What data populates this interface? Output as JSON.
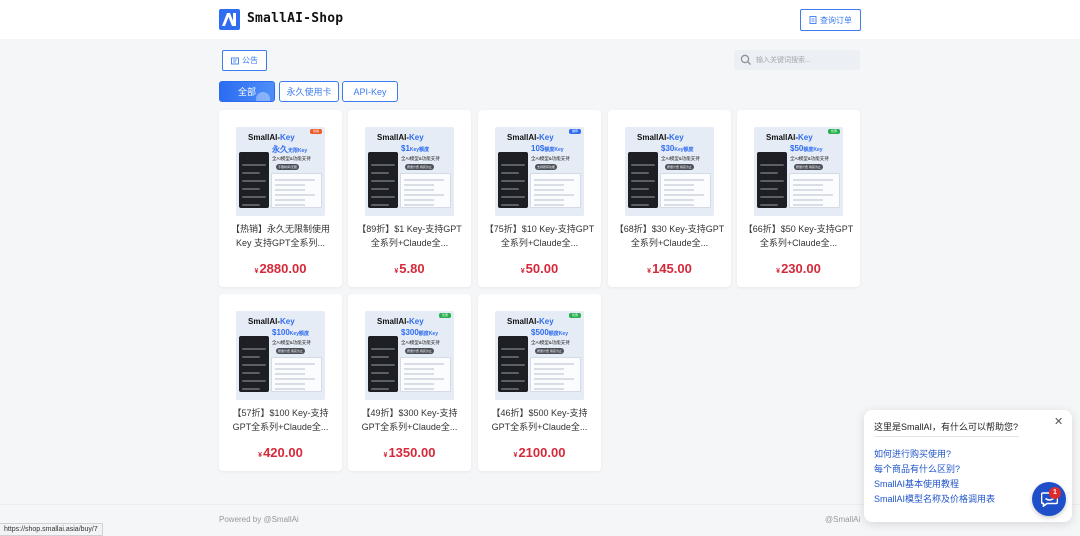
{
  "header": {
    "brand": "SmallAI-Shop",
    "order_button": "查询订单"
  },
  "toolbar": {
    "notice_button": "公告",
    "search_placeholder": "输入关键词搜索..."
  },
  "tabs": [
    {
      "label": "全部",
      "active": true
    },
    {
      "label": "永久使用卡",
      "active": false
    },
    {
      "label": "API-Key",
      "active": false
    }
  ],
  "products": [
    {
      "title": "【热销】永久无限制使用Key 支持GPT全系列...",
      "currency": "¥",
      "price": "2880.00",
      "thumb": {
        "brand": "SmallAI-",
        "brand_key": "Key",
        "headline": "永久",
        "headline_small": "无限Key",
        "subline": "全AI模型&功能支持",
        "pill": "不限时间/无限",
        "badge": "热销",
        "badge_color": "#f05a2a"
      }
    },
    {
      "title": "【89折】$1 Key-支持GPT全系列+Claude全...",
      "currency": "¥",
      "price": "5.80",
      "thumb": {
        "brand": "SmallAI-",
        "brand_key": "Key",
        "headline": "$1",
        "headline_small": "Key额度",
        "subline": "全AI模型&功能支持",
        "pill": "按量计费 用完为止",
        "badge": "",
        "badge_color": ""
      }
    },
    {
      "title": "【75折】$10 Key-支持GPT全系列+Claude全...",
      "currency": "¥",
      "price": "50.00",
      "thumb": {
        "brand": "SmallAI-",
        "brand_key": "Key",
        "headline": "10$",
        "headline_small": "额度Key",
        "subline": "全AI模型&功能支持",
        "pill": "支持所有功能",
        "badge": "推荐",
        "badge_color": "#2f6df0"
      }
    },
    {
      "title": "【68折】$30 Key-支持GPT全系列+Claude全...",
      "currency": "¥",
      "price": "145.00",
      "thumb": {
        "brand": "SmallAI-",
        "brand_key": "Key",
        "headline": "$30",
        "headline_small": "Key额度",
        "subline": "全AI模型&功能支持",
        "pill": "按量计费 用完为止",
        "badge": "",
        "badge_color": ""
      }
    },
    {
      "title": "【66折】$50 Key-支持GPT全系列+Claude全...",
      "currency": "¥",
      "price": "230.00",
      "thumb": {
        "brand": "SmallAI-",
        "brand_key": "Key",
        "headline": "$50",
        "headline_small": "额度Key",
        "subline": "全AI模型&功能支持",
        "pill": "按量计费 用完为止",
        "badge": "优惠",
        "badge_color": "#25b04d"
      }
    },
    {
      "title": "【57折】$100 Key-支持GPT全系列+Claude全...",
      "currency": "¥",
      "price": "420.00",
      "thumb": {
        "brand": "SmallAI-",
        "brand_key": "Key",
        "headline": "$100",
        "headline_small": "Key额度",
        "subline": "全AI模型&功能支持",
        "pill": "按量计费 用完为止",
        "badge": "",
        "badge_color": ""
      }
    },
    {
      "title": "【49折】$300 Key-支持GPT全系列+Claude全...",
      "currency": "¥",
      "price": "1350.00",
      "thumb": {
        "brand": "SmallAI-",
        "brand_key": "Key",
        "headline": "$300",
        "headline_small": "额度Key",
        "subline": "全AI模型&功能支持",
        "pill": "按量计费 用完为止",
        "badge": "优惠",
        "badge_color": "#25b04d"
      }
    },
    {
      "title": "【46折】$500 Key-支持GPT全系列+Claude全...",
      "currency": "¥",
      "price": "2100.00",
      "thumb": {
        "brand": "SmallAI-",
        "brand_key": "Key",
        "headline": "$500",
        "headline_small": "额度Key",
        "subline": "全AI模型&功能支持",
        "pill": "按量计费 用完为止",
        "badge": "优惠",
        "badge_color": "#25b04d"
      }
    }
  ],
  "footer": {
    "left": "Powered by @SmallAi",
    "right": "@SmallAi"
  },
  "status_url": "https://shop.smallai.asia/buy/7",
  "chat": {
    "question": "这里是SmallAI，有什么可以帮助您?",
    "links": [
      "如何进行购买使用?",
      "每个商品有什么区别?",
      "SmallAI基本使用教程",
      "SmallAI模型名称及价格调用表"
    ],
    "unread": "1"
  },
  "colors": {
    "accent": "#3c7cf0",
    "price": "#d5293a",
    "chat_fab": "#1e4fc9"
  }
}
